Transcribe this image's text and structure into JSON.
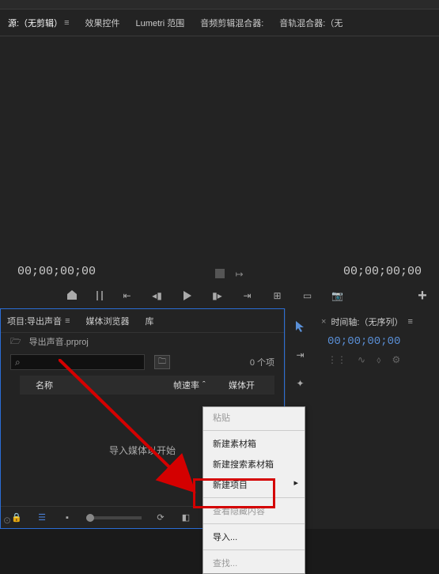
{
  "sourceTabs": {
    "source": "源:（无剪辑）",
    "effects": "效果控件",
    "lumetri": "Lumetri 范围",
    "audioClipMixer": "音频剪辑混合器:",
    "audioTrackMixer": "音轨混合器:（无"
  },
  "monitor": {
    "timeLeft": "00;00;00;00",
    "timeRight": "00;00;00;00"
  },
  "projectPanel": {
    "tabs": {
      "project": "项目:导出声音",
      "mediaBrowser": "媒体浏览器",
      "library": "库"
    },
    "fileName": "导出声音.prproj",
    "searchPlaceholder": "",
    "itemCount": "0 个项",
    "columns": {
      "name": "名称",
      "fps": "帧速率",
      "mediaOpen": "媒体开"
    },
    "emptyHint": "导入媒体以开始"
  },
  "timelinePanel": {
    "title": "时间轴:（无序列）",
    "time": "00;00;00;00"
  },
  "contextMenu": {
    "paste": "粘贴",
    "newBin": "新建素材箱",
    "newSearchBin": "新建搜索素材箱",
    "newItem": "新建项目",
    "viewHidden": "查看隐藏内容",
    "import": "导入...",
    "find": "查找..."
  }
}
